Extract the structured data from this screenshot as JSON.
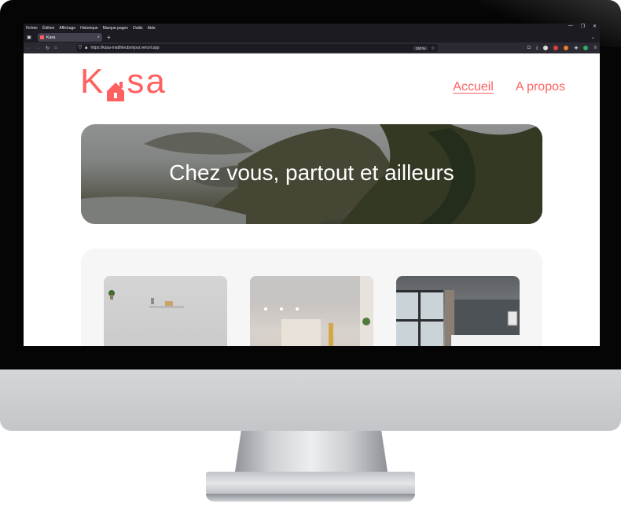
{
  "browser": {
    "menu": [
      "Fichier",
      "Édition",
      "Affichage",
      "Historique",
      "Marque-pages",
      "Outils",
      "Aide"
    ],
    "tab_title": "Kasa",
    "url": "https://kasa-matthieubonjour.vercel.app",
    "zoom": "110 %"
  },
  "site": {
    "logo_prefix": "K",
    "logo_suffix": "sa",
    "nav": [
      "Accueil",
      "A propos"
    ],
    "banner_title": "Chez vous, partout et ailleurs"
  },
  "colors": {
    "brand": "#FF6060"
  }
}
